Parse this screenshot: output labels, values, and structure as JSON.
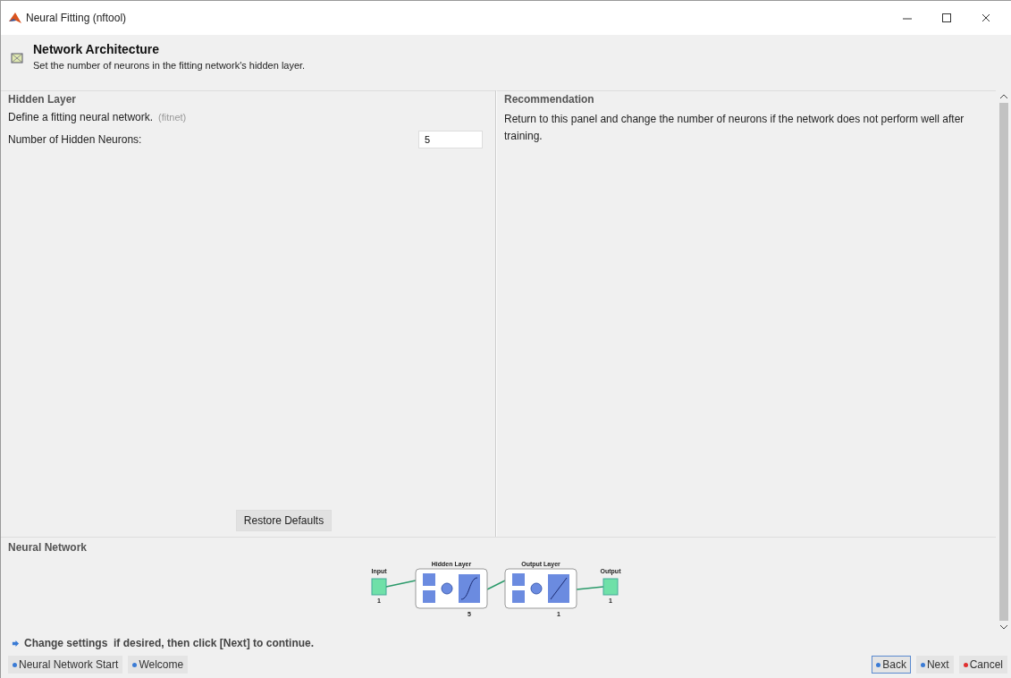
{
  "window": {
    "title": "Neural Fitting (nftool)"
  },
  "header": {
    "title": "Network Architecture",
    "subtitle": "Set the number of neurons in the fitting network's hidden layer."
  },
  "hidden_layer": {
    "title": "Hidden Layer",
    "description": "Define a fitting neural network.",
    "function": "(fitnet)",
    "field_label": "Number of Hidden Neurons:",
    "field_value": "5",
    "restore_button": "Restore Defaults"
  },
  "recommendation": {
    "title": "Recommendation",
    "text": "Return to this panel and change the number of neurons if the network does not perform well after training."
  },
  "neural_network": {
    "title": "Neural Network",
    "diagram": {
      "input": {
        "label": "Input",
        "size": "1"
      },
      "layers": [
        {
          "label": "Hidden Layer",
          "size": "5",
          "kind": "sigmoid"
        },
        {
          "label": "Output Layer",
          "size": "1",
          "kind": "linear"
        }
      ],
      "output": {
        "label": "Output",
        "size": "1"
      }
    }
  },
  "hint": "Change settings  if desired, then click [Next] to continue.",
  "nav_left": [
    {
      "label": "Neural Network Start",
      "kind": "start"
    },
    {
      "label": "Welcome",
      "kind": "start"
    }
  ],
  "nav_right": [
    {
      "label": "Back",
      "kind": "back",
      "focused": true
    },
    {
      "label": "Next",
      "kind": "next",
      "focused": false
    },
    {
      "label": "Cancel",
      "kind": "cancel",
      "focused": false
    }
  ]
}
